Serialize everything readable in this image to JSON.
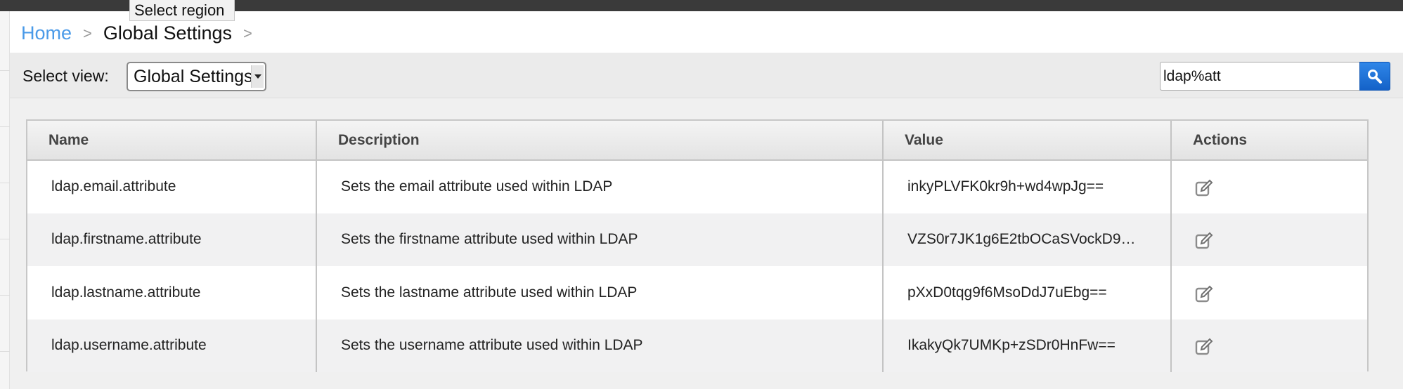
{
  "tooltip": "Select region",
  "breadcrumb": {
    "home": "Home",
    "sep1": ">",
    "current": "Global Settings",
    "sep2": ">"
  },
  "toolbar": {
    "view_label": "Select view:",
    "view_selected": "Global Settings",
    "search_value": "ldap%att",
    "search_icon": "search-icon"
  },
  "table": {
    "headers": [
      "Name",
      "Description",
      "Value",
      "Actions"
    ],
    "rows": [
      {
        "name": "ldap.email.attribute",
        "description": "Sets the email attribute used within LDAP",
        "value": "inkyPLVFK0kr9h+wd4wpJg==",
        "action_icon": "edit-icon"
      },
      {
        "name": "ldap.firstname.attribute",
        "description": "Sets the firstname attribute used within LDAP",
        "value": "VZS0r7JK1g6E2tbOCaSVockD9…",
        "action_icon": "edit-icon"
      },
      {
        "name": "ldap.lastname.attribute",
        "description": "Sets the lastname attribute used within LDAP",
        "value": "pXxD0tqg9f6MsoDdJ7uEbg==",
        "action_icon": "edit-icon"
      },
      {
        "name": "ldap.username.attribute",
        "description": "Sets the username attribute used within LDAP",
        "value": "IkakyQk7UMKp+zSDr0HnFw==",
        "action_icon": "edit-icon"
      }
    ]
  },
  "colors": {
    "link": "#4a9ae8",
    "search_button": "#1f72d8"
  }
}
